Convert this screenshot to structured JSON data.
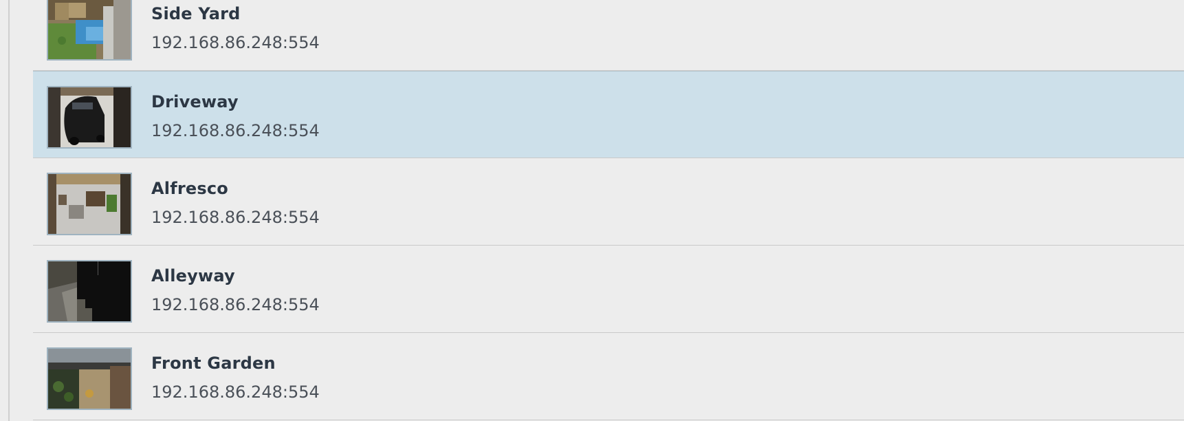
{
  "cameras": [
    {
      "name": "Side Yard",
      "address": "192.168.86.248:554",
      "selected": false,
      "thumbnail": "side-yard-thumbnail"
    },
    {
      "name": "Driveway",
      "address": "192.168.86.248:554",
      "selected": true,
      "thumbnail": "driveway-thumbnail"
    },
    {
      "name": "Alfresco",
      "address": "192.168.86.248:554",
      "selected": false,
      "thumbnail": "alfresco-thumbnail"
    },
    {
      "name": "Alleyway",
      "address": "192.168.86.248:554",
      "selected": false,
      "thumbnail": "alleyway-thumbnail"
    },
    {
      "name": "Front Garden",
      "address": "192.168.86.248:554",
      "selected": false,
      "thumbnail": "front-garden-thumbnail"
    }
  ],
  "colors": {
    "background": "#ededed",
    "selected_row": "#cde0ea",
    "name_text": "#2c3744",
    "address_text": "#4a5058"
  }
}
